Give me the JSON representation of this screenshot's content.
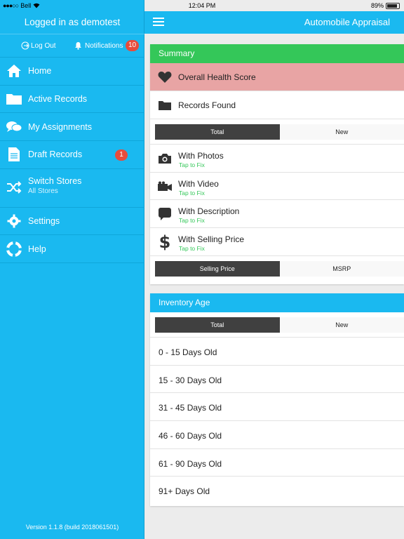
{
  "status_bar": {
    "carrier": "Bell",
    "time": "12:04 PM",
    "battery": "89%",
    "battery_level": 0.89
  },
  "sidebar": {
    "header": "Logged in as demotest",
    "logout_label": "Log Out",
    "notifications_label": "Notifications",
    "notifications_count": "10",
    "items": [
      {
        "label": "Home",
        "icon": "home-icon"
      },
      {
        "label": "Active Records",
        "icon": "folder-icon"
      },
      {
        "label": "My Assignments",
        "icon": "chat-bubbles-icon"
      },
      {
        "label": "Draft Records",
        "icon": "document-icon",
        "badge": "1"
      },
      {
        "label": "Switch Stores",
        "sub": "All Stores",
        "icon": "shuffle-icon"
      },
      {
        "label": "Settings",
        "icon": "gear-icon"
      },
      {
        "label": "Help",
        "icon": "lifebuoy-icon"
      }
    ],
    "version": "Version 1.1.8 (build 2018061501)"
  },
  "topbar": {
    "title": "Automobile Appraisal"
  },
  "summary": {
    "header": "Summary",
    "health_label": "Overall Health Score",
    "records_label": "Records Found",
    "segment1": {
      "active": "Total",
      "inactive": "New"
    },
    "stats": [
      {
        "label": "With Photos",
        "fix": "Tap to Fix",
        "icon": "camera-icon"
      },
      {
        "label": "With Video",
        "fix": "Tap to Fix",
        "icon": "video-camera-icon"
      },
      {
        "label": "With Description",
        "fix": "Tap to Fix",
        "icon": "speech-bubble-icon"
      },
      {
        "label": "With Selling Price",
        "fix": "Tap to Fix",
        "icon": "dollar-icon"
      }
    ],
    "segment2": {
      "active": "Selling Price",
      "inactive": "MSRP"
    }
  },
  "inventory": {
    "header": "Inventory Age",
    "segment": {
      "active": "Total",
      "inactive": "New"
    },
    "ages": [
      "0 - 15 Days Old",
      "15 - 30 Days Old",
      "31 - 45 Days Old",
      "46 - 60 Days Old",
      "61 - 90 Days Old",
      "91+ Days Old"
    ]
  },
  "colors": {
    "accent": "#1ab9f0",
    "success": "#34c759",
    "health_bg": "#e8a4a4",
    "badge": "#e74c3c",
    "segment_active": "#404040"
  }
}
